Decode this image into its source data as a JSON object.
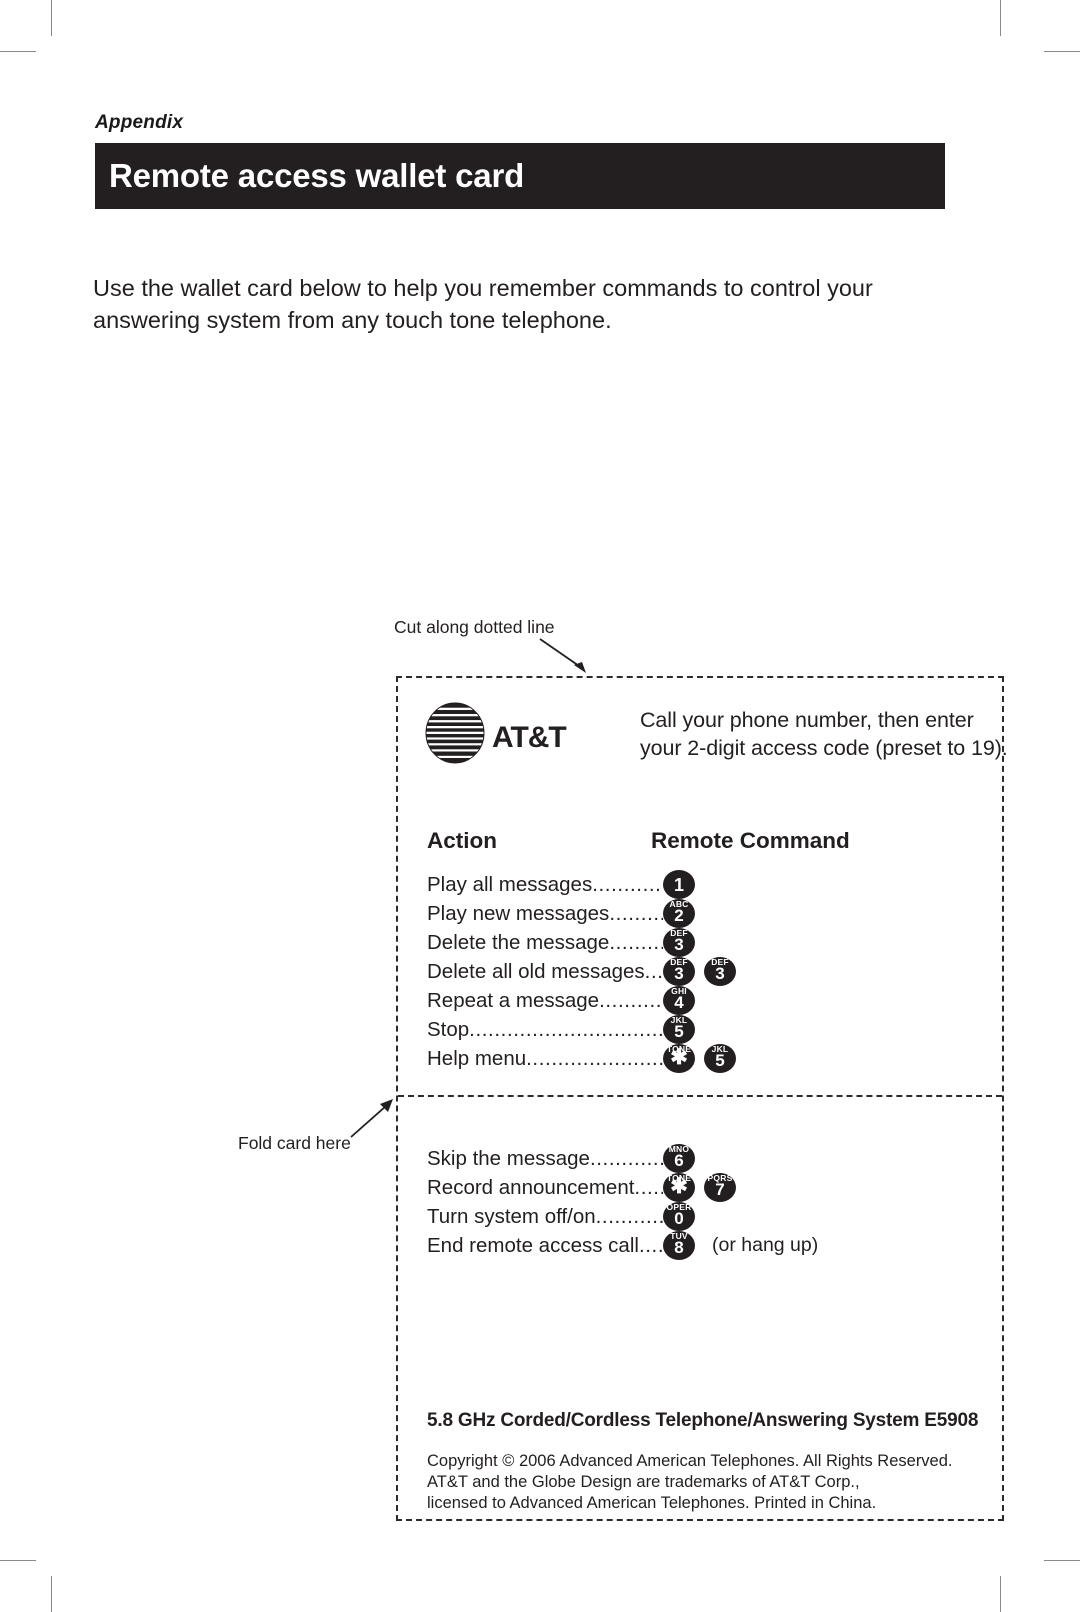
{
  "page": {
    "appendix_label": "Appendix",
    "title": "Remote access wallet card",
    "intro": "Use the wallet card below to help you remember commands to control your answering system from any touch tone telephone.",
    "cut_note": "Cut along dotted line",
    "fold_note": "Fold card here"
  },
  "card": {
    "brand": "AT&T",
    "headline": "Call your phone number, then enter your 2-digit access code (preset to 19).",
    "columns": {
      "action": "Action",
      "remote_command": "Remote Command"
    },
    "rows_top": [
      {
        "action": "Play all messages",
        "dots": ".......................",
        "keys": [
          {
            "letters": "",
            "digit": "1"
          }
        ],
        "note": ""
      },
      {
        "action": "Play new messages",
        "dots": "...................",
        "keys": [
          {
            "letters": "ABC",
            "digit": "2"
          }
        ],
        "note": ""
      },
      {
        "action": "Delete the message",
        "dots": ".................",
        "keys": [
          {
            "letters": "DEF",
            "digit": "3"
          }
        ],
        "note": ""
      },
      {
        "action": "Delete all old messages",
        "dots": "..........",
        "keys": [
          {
            "letters": "DEF",
            "digit": "3"
          },
          {
            "letters": "DEF",
            "digit": "3"
          }
        ],
        "note": ""
      },
      {
        "action": "Repeat a message",
        "dots": "....................",
        "keys": [
          {
            "letters": "GHI",
            "digit": "4"
          }
        ],
        "note": ""
      },
      {
        "action": "Stop",
        "dots": "...............................................",
        "keys": [
          {
            "letters": "JKL",
            "digit": "5"
          }
        ],
        "note": ""
      },
      {
        "action": "Help menu",
        "dots": "................................",
        "keys": [
          {
            "letters": "TONE",
            "digit": "✱"
          },
          {
            "letters": "JKL",
            "digit": "5"
          }
        ],
        "note": ""
      }
    ],
    "rows_bottom": [
      {
        "action": "Skip the message",
        "dots": ".......................",
        "keys": [
          {
            "letters": "MNO",
            "digit": "6"
          }
        ],
        "note": ""
      },
      {
        "action": "Record announcement",
        "dots": "............",
        "keys": [
          {
            "letters": "TONE",
            "digit": "✱"
          },
          {
            "letters": "PQRS",
            "digit": "7"
          }
        ],
        "note": ""
      },
      {
        "action": "Turn system off/on",
        "dots": "...................",
        "keys": [
          {
            "letters": "OPER",
            "digit": "0"
          }
        ],
        "note": ""
      },
      {
        "action": "End remote access call",
        "dots": "............",
        "keys": [
          {
            "letters": "TUV",
            "digit": "8"
          }
        ],
        "note": "(or hang up)"
      }
    ],
    "product_line": "5.8 GHz Corded/Cordless Telephone/Answering System E5908",
    "copyright": [
      "Copyright © 2006 Advanced American Telephones. All Rights Reserved.",
      "AT&T and the Globe Design are trademarks of AT&T Corp.,",
      "licensed to Advanced American Telephones. Printed in China."
    ]
  },
  "colors": {
    "ink": "#231f20",
    "paper": "#ffffff",
    "crop_mark": "#8a8a8a"
  }
}
